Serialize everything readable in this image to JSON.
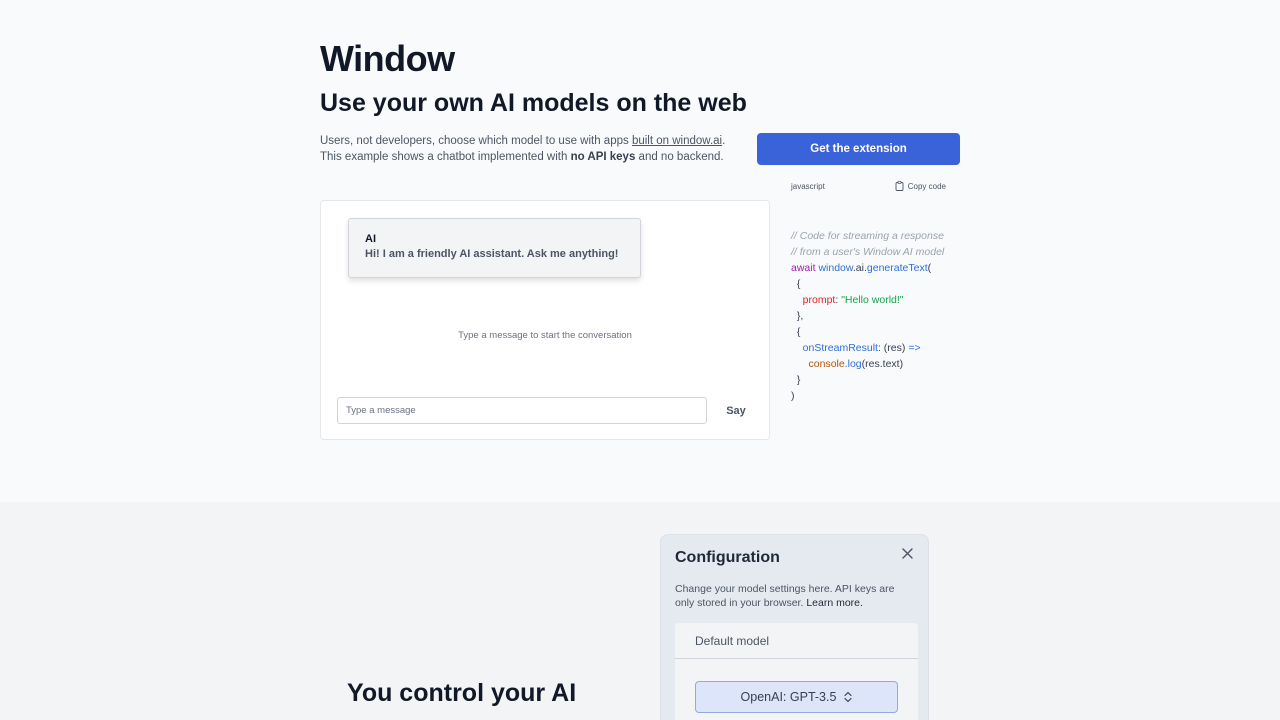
{
  "hero": {
    "brand": "Window",
    "headline": "Use your own AI models on the web",
    "intro_line1_a": "Users, not developers, choose which model to use with apps ",
    "intro_link": "built on window.ai",
    "intro_line1_b": ".",
    "intro_line2_a": "This example shows a chatbot implemented with ",
    "intro_bold": "no API keys",
    "intro_line2_b": " and no backend.",
    "cta_label": "Get the extension"
  },
  "code_card": {
    "language": "javascript",
    "copy_label": "Copy code",
    "icon": "clipboard-icon",
    "lines": {
      "comment1": "// Code for streaming a response",
      "comment2": "// from a user's Window AI model",
      "await": "await",
      "window": "window",
      "ai": ".ai.",
      "generate": "generateText",
      "open_paren": "(",
      "brace_open1": "  {",
      "prompt_key": "prompt",
      "prompt_colon": ": ",
      "prompt_val": "\"Hello world!\"",
      "brace_close1": "  },",
      "brace_open2": "  {",
      "stream_key": "onStreamResult",
      "stream_rest": ": (res) ",
      "arrow": "=>",
      "console": "console",
      "log": ".log",
      "log_args": "(res.text)",
      "brace_close2": "  }",
      "close_paren": ")"
    }
  },
  "chat": {
    "bubble_author": "AI",
    "bubble_message": "Hi! I am a friendly AI assistant. Ask me anything!",
    "empty_hint": "Type a message to start the conversation",
    "input_placeholder": "Type a message",
    "input_value": "",
    "send_label": "Say"
  },
  "lower": {
    "heading": "You control your AI"
  },
  "config": {
    "title": "Configuration",
    "close_icon": "close-icon",
    "description": "Change your model settings here. API keys are only stored in your browser. ",
    "learn_more": "Learn more.",
    "panel_title": "Default model",
    "selected_model": "OpenAI: GPT-3.5",
    "select_icon": "chevron-up-down-icon"
  },
  "colors": {
    "accent": "#3b63d9",
    "background": "#f9fafb",
    "lower_background": "#f3f4f6"
  }
}
